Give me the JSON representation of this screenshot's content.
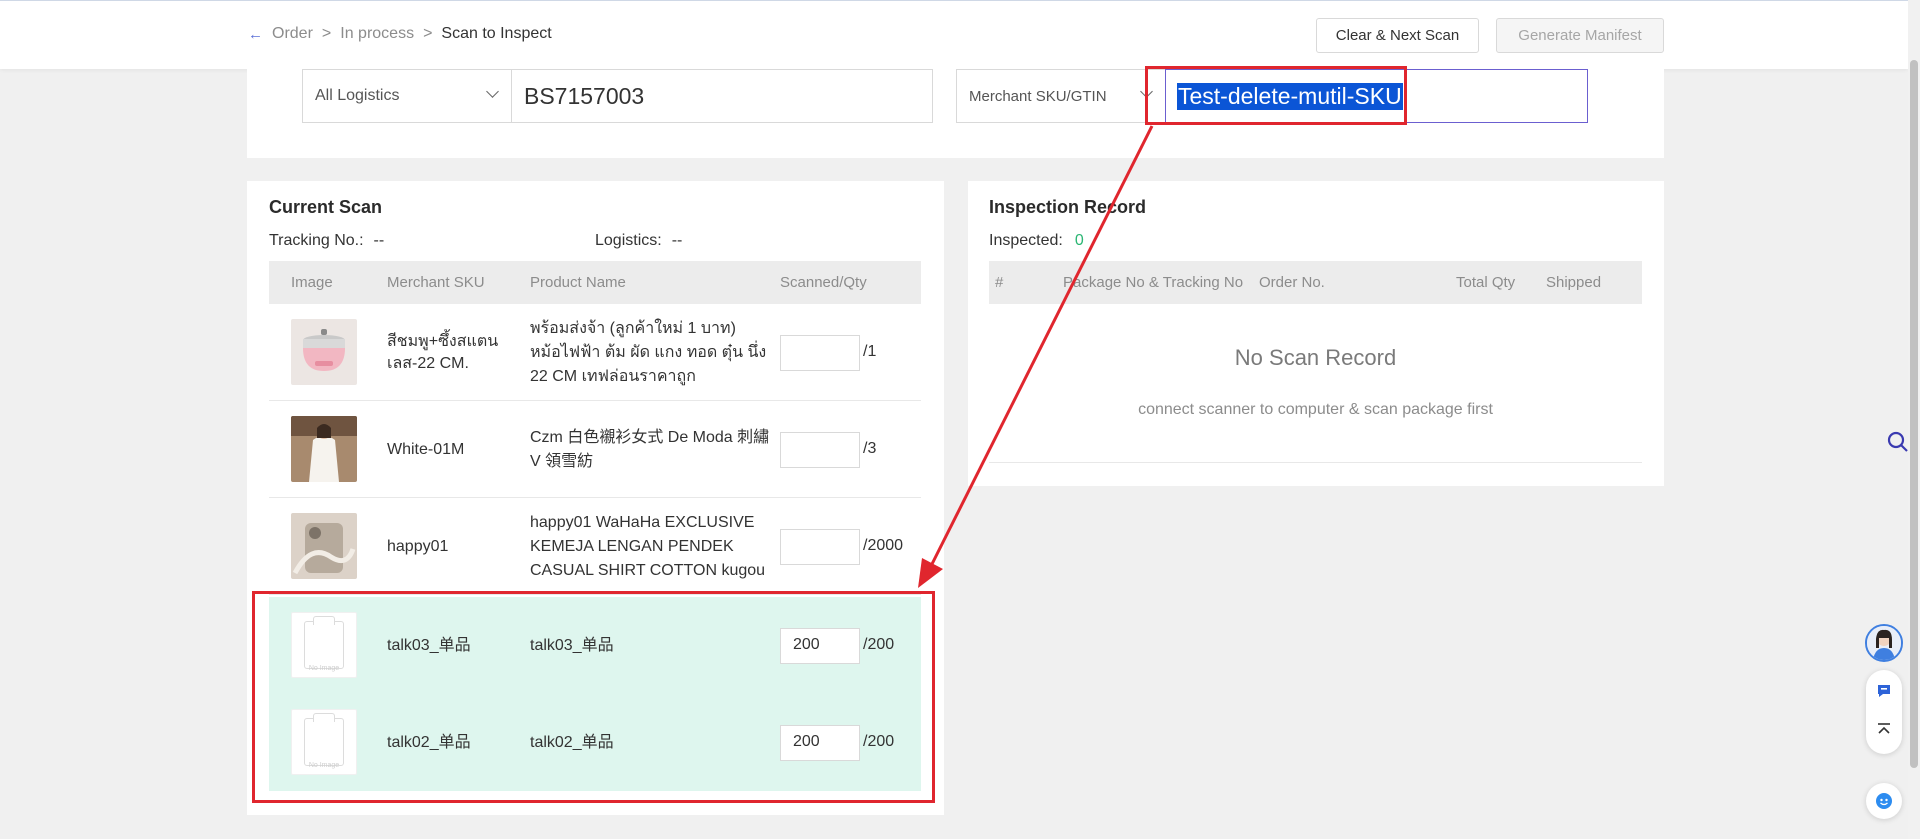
{
  "breadcrumb": {
    "back_icon": "arrow-left-icon",
    "order": "Order",
    "in_process": "In process",
    "current": "Scan to Inspect",
    "separator": ">"
  },
  "header_buttons": {
    "clear_next": "Clear & Next Scan",
    "generate_manifest": "Generate Manifest"
  },
  "scan": {
    "logistics_select": "All Logistics",
    "order_input_value": "BS7157003",
    "sku_select": "Merchant SKU/GTIN",
    "sku_input_value": "Test-delete-mutil-SKU"
  },
  "current_scan": {
    "title": "Current Scan",
    "tracking_label": "Tracking No.:",
    "tracking_value": "--",
    "logistics_label": "Logistics:",
    "logistics_value": "--",
    "columns": [
      "Image",
      "Merchant SKU",
      "Product Name",
      "Scanned/Qty"
    ],
    "rows": [
      {
        "sku": "สีชมพู+ซึ้งสแตนเลส-22 CM.",
        "product": "พร้อมส่งจ้า (ลูกค้าใหม่ 1 บาท) หม้อไฟฟ้า ต้ม ผัด แกง ทอด ตุ๋น นึ่ง 22 CM เทฟล่อนราคาถูก",
        "scanned": "",
        "qty": "/1",
        "image": "pink-electric-pot",
        "highlight": false
      },
      {
        "sku": "White-01M",
        "product": "Czm 白色襯衫女式 De Moda 刺繡 V 領雪紡",
        "scanned": "",
        "qty": "/3",
        "image": "white-blouse-photo",
        "highlight": false
      },
      {
        "sku": "happy01",
        "product": "happy01 WaHaHa EXCLUSIVE KEMEJA LENGAN PENDEK CASUAL SHIRT COTTON kugou",
        "scanned": "",
        "qty": "/2000",
        "image": "phone-case-photo",
        "highlight": false
      },
      {
        "sku": "talk03_单品",
        "product": "talk03_单品",
        "scanned": "200",
        "qty": "/200",
        "image": "no-image",
        "highlight": true
      },
      {
        "sku": "talk02_单品",
        "product": "talk02_单品",
        "scanned": "200",
        "qty": "/200",
        "image": "no-image",
        "highlight": true
      }
    ],
    "no_image_text": "No Image"
  },
  "inspection_record": {
    "title": "Inspection Record",
    "inspected_label": "Inspected:",
    "inspected_count": "0",
    "columns": [
      "#",
      "Package No & Tracking No",
      "Order No.",
      "Total Qty",
      "Shipped"
    ],
    "empty_title": "No Scan Record",
    "empty_subtitle": "connect scanner to computer & scan package first"
  },
  "colors": {
    "accent_purple": "#5b6fd6",
    "annotation_red": "#e0262e",
    "highlight_row": "#def6ee",
    "selection_blue": "#0b55d6",
    "success_green": "#2bb673"
  },
  "side_widgets": [
    "search-icon",
    "support-avatar",
    "chat-icon",
    "back-to-top-icon",
    "help-bot-icon"
  ]
}
